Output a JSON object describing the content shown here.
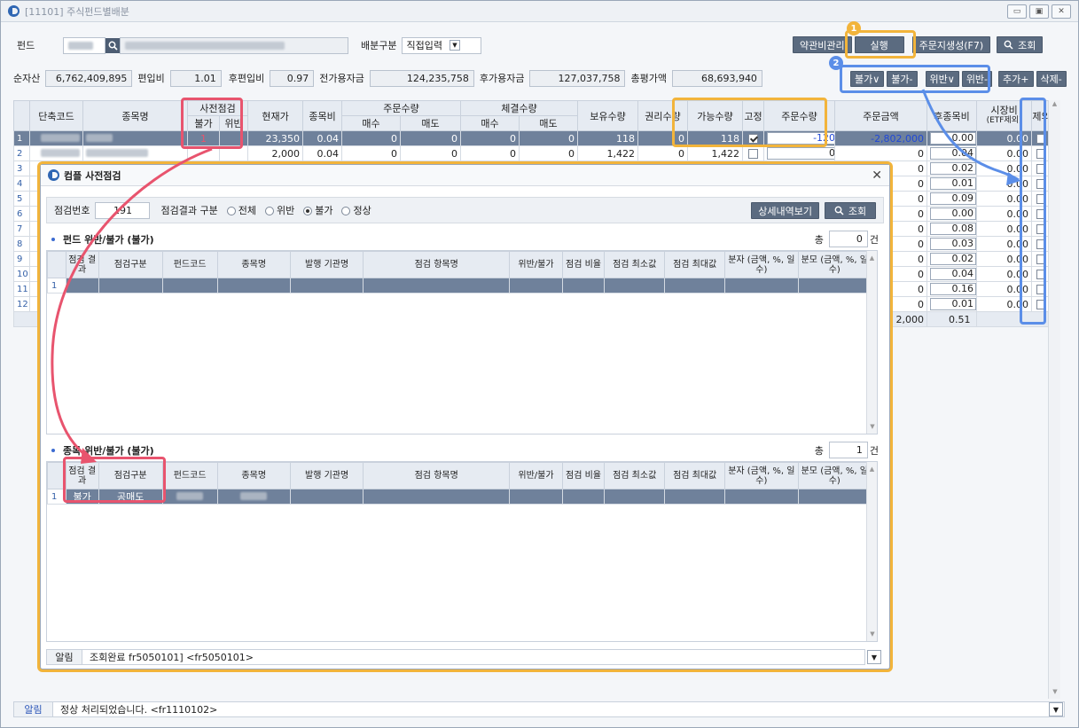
{
  "window": {
    "title": "[11101] 주식펀드별배분"
  },
  "top": {
    "fund_label": "펀드",
    "dist_label": "배분구분",
    "dist_value": "직접입력",
    "btn_fee": "약관비관리",
    "btn_run": "실행",
    "btn_order": "주문지생성(F7)",
    "btn_search": "조회"
  },
  "summary": [
    {
      "label": "순자산",
      "value": "6,762,409,895"
    },
    {
      "label": "편입비",
      "value": "1.01"
    },
    {
      "label": "후편입비",
      "value": "0.97"
    },
    {
      "label": "전가용자금",
      "value": "124,235,758"
    },
    {
      "label": "후가용자금",
      "value": "127,037,758"
    },
    {
      "label": "총평가액",
      "value": "68,693,940"
    }
  ],
  "actions": [
    "불가∨",
    "불가-",
    "위반∨",
    "위반-",
    "추가+",
    "삭제-"
  ],
  "badges": {
    "one": "1",
    "two": "2"
  },
  "grid": {
    "headers": {
      "short_code": "단축코드",
      "name": "종목명",
      "precheck": "사전점검",
      "impossible": "불가",
      "violation": "위반",
      "price": "현재가",
      "weight": "종목비",
      "order_qty_grp": "주문수량",
      "buy": "매수",
      "sell": "매도",
      "exec_qty_grp": "체결수량",
      "hold": "보유수량",
      "right": "권리수량",
      "avail": "가능수량",
      "fixed": "고정",
      "order_qty": "주문수량",
      "order_amt": "주문금액",
      "post_weight": "후종목비",
      "mkt_weight": "시장비",
      "mkt_weight_sub": "(ETF제외)",
      "exclude": "제외"
    },
    "rows": [
      {
        "n": "1",
        "flag": "1",
        "price": "23,350",
        "w": "0.04",
        "b": "0",
        "s": "0",
        "eb": "0",
        "es": "0",
        "hold": "118",
        "right": "0",
        "avail": "118",
        "fixed": true,
        "oq": "-120",
        "amt": "-2,802,000",
        "pw": "0.00",
        "mw": "0.00"
      },
      {
        "n": "2",
        "flag": "",
        "price": "2,000",
        "w": "0.04",
        "b": "0",
        "s": "0",
        "eb": "0",
        "es": "0",
        "hold": "1,422",
        "right": "0",
        "avail": "1,422",
        "fixed": false,
        "oq": "0",
        "amt": "0",
        "pw": "0.04",
        "mw": "0.00"
      },
      {
        "n": "3",
        "amt": "0",
        "pw": "0.02",
        "mw": "0.00"
      },
      {
        "n": "4",
        "amt": "0",
        "pw": "0.01",
        "mw": "0.00"
      },
      {
        "n": "5",
        "amt": "0",
        "pw": "0.09",
        "mw": "0.00"
      },
      {
        "n": "6",
        "amt": "0",
        "pw": "0.00",
        "mw": "0.00"
      },
      {
        "n": "7",
        "amt": "0",
        "pw": "0.08",
        "mw": "0.00"
      },
      {
        "n": "8",
        "amt": "0",
        "pw": "0.03",
        "mw": "0.00"
      },
      {
        "n": "9",
        "amt": "0",
        "pw": "0.02",
        "mw": "0.00"
      },
      {
        "n": "10",
        "amt": "0",
        "pw": "0.04",
        "mw": "0.00"
      },
      {
        "n": "11",
        "amt": "0",
        "pw": "0.16",
        "mw": "0.00"
      },
      {
        "n": "12",
        "amt": "0",
        "pw": "0.01",
        "mw": "0.00"
      }
    ],
    "total": {
      "amt": "2,000",
      "pw": "0.51"
    }
  },
  "popup": {
    "title": "컴플 사전점검",
    "check_no_label": "점검번호",
    "check_no": "191",
    "result_label": "점검결과 구분",
    "radios": [
      "전체",
      "위반",
      "불가",
      "정상"
    ],
    "btn_detail": "상세내역보기",
    "btn_search": "조회",
    "fund_section": "펀드 위반/불가 (불가)",
    "item_section": "종목 위반/불가 (불가)",
    "total_label": "총",
    "count_unit": "건",
    "fund_count": "0",
    "item_count": "1",
    "cols": [
      "점검 결과",
      "점검구분",
      "펀드코드",
      "종목명",
      "발행 기관명",
      "점검 항목명",
      "위반/불가",
      "점검 비율",
      "점검 최소값",
      "점검 최대값",
      "분자 (금액, %, 일수)",
      "분모 (금액, %, 일수)"
    ],
    "item_row": {
      "result": "불가",
      "kind": "공매도"
    },
    "status_tag": "알림",
    "status_msg": "조회완료 fr5050101] <fr5050101>"
  },
  "statusbar": {
    "tag": "알림",
    "msg": "정상 처리되었습니다. <fr1110102>"
  }
}
